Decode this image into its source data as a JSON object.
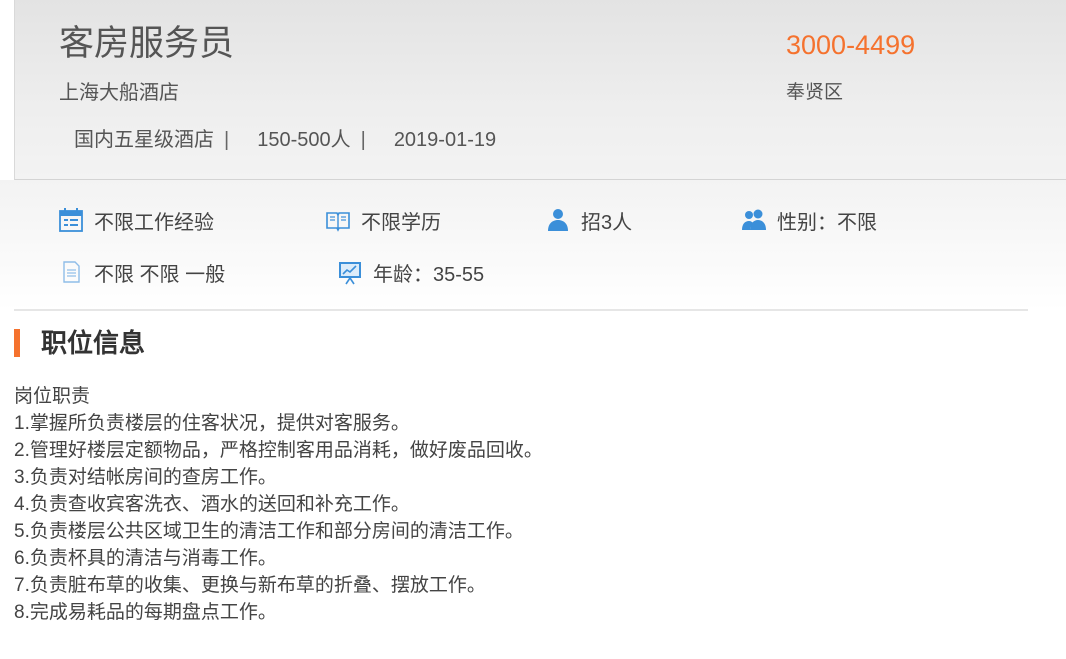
{
  "job": {
    "title": "客房服务员",
    "company": "上海大船酒店",
    "salary": "3000-4499",
    "district": "奉贤区",
    "meta": [
      "国内五星级酒店",
      "150-500人",
      "2019-01-19"
    ],
    "meta_separator": "|"
  },
  "requirements": [
    {
      "icon": "calendar-icon",
      "text": "不限工作经验"
    },
    {
      "icon": "book-icon",
      "text": "不限学历"
    },
    {
      "icon": "person-icon",
      "text": "招3人"
    },
    {
      "icon": "people-icon",
      "text": "性别：不限"
    },
    {
      "icon": "document-icon",
      "text": "不限 不限 一般"
    },
    {
      "icon": "presentation-icon",
      "text": "年龄：35-55"
    }
  ],
  "section": {
    "title": "职位信息"
  },
  "description": {
    "heading": "岗位职责",
    "lines": [
      "1.掌握所负责楼层的住客状况，提供对客服务。",
      "2.管理好楼层定额物品，严格控制客用品消耗，做好废品回收。",
      "3.负责对结帐房间的查房工作。",
      "4.负责查收宾客洗衣、酒水的送回和补充工作。",
      "5.负责楼层公共区域卫生的清洁工作和部分房间的清洁工作。",
      "6.负责杯具的清洁与消毒工作。",
      "7.负责脏布草的收集、更换与新布草的折叠、摆放工作。",
      "8.完成易耗品的每期盘点工作。"
    ]
  },
  "colors": {
    "accent": "#f5722e",
    "icon_blue": "#3b8fd9"
  }
}
